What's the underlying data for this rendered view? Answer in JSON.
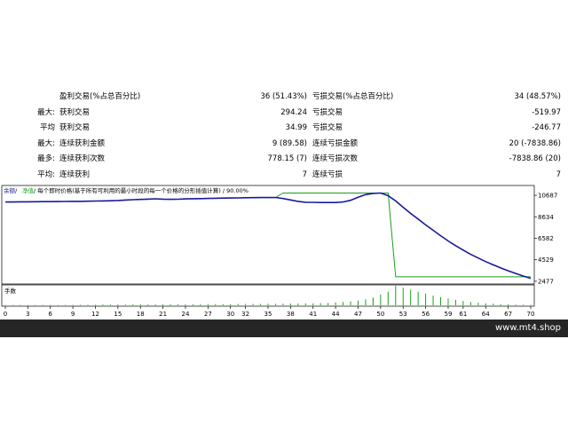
{
  "stats": {
    "rows": [
      {
        "c0": "",
        "c1": "盈利交易(%占总百分比)",
        "c2": "36 (51.43%)",
        "c3": "亏损交易(%占总百分比)",
        "c4": "34 (48.57%)"
      },
      {
        "c0": "最大:",
        "c1": "获利交易",
        "c2": "294.24",
        "c3": "亏损交易",
        "c4": "-519.97"
      },
      {
        "c0": "平均",
        "c1": "获利交易",
        "c2": "34.99",
        "c3": "亏损交易",
        "c4": "-246.77"
      },
      {
        "c0": "最大:",
        "c1": "连续获利金额",
        "c2": "9 (89.58)",
        "c3": "连续亏损金额",
        "c4": "20 (-7838.86)"
      },
      {
        "c0": "最多:",
        "c1": "连续获利次数",
        "c2": "778.15 (7)",
        "c3": "连续亏损次数",
        "c4": "-7838.86 (20)"
      },
      {
        "c0": "平均:",
        "c1": "连续获利",
        "c2": "7",
        "c3": "连续亏损",
        "c4": "7"
      }
    ]
  },
  "chart": {
    "legend": {
      "balance": "余额",
      "sep1": " / ",
      "equity": "净值",
      "rest": " / 每个即时价格(基于所有可利用的最小时段的每一个价格的分形插值计算) / 90.00%"
    },
    "volume_label": "手数",
    "colors": {
      "balance": "#1a1a9c",
      "equity": "#1b9e1b",
      "volume": "#1b9e1b",
      "axis": "#000000"
    },
    "chart_data": {
      "type": "line",
      "x": [
        0,
        1,
        2,
        3,
        4,
        5,
        6,
        7,
        8,
        9,
        10,
        11,
        12,
        13,
        14,
        15,
        16,
        17,
        18,
        19,
        20,
        21,
        22,
        23,
        24,
        25,
        26,
        27,
        28,
        29,
        30,
        31,
        32,
        33,
        34,
        35,
        36,
        37,
        38,
        39,
        40,
        41,
        42,
        43,
        44,
        45,
        46,
        47,
        48,
        49,
        50,
        51,
        52,
        53,
        54,
        55,
        56,
        57,
        58,
        59,
        60,
        61,
        62,
        63,
        64,
        65,
        66,
        67,
        68,
        69,
        70
      ],
      "series": [
        {
          "name": "余额",
          "values": [
            10050,
            10050,
            10060,
            10060,
            10070,
            10080,
            10080,
            10090,
            10100,
            10110,
            10110,
            10120,
            10140,
            10150,
            10170,
            10190,
            10230,
            10270,
            10290,
            10320,
            10350,
            10320,
            10300,
            10310,
            10340,
            10360,
            10370,
            10390,
            10400,
            10420,
            10430,
            10440,
            10450,
            10460,
            10470,
            10470,
            10480,
            10380,
            10240,
            10110,
            10020,
            10010,
            10000,
            10000,
            10000,
            10050,
            10210,
            10500,
            10750,
            10870,
            10900,
            10650,
            10150,
            9550,
            8950,
            8420,
            7860,
            7340,
            6830,
            6330,
            5880,
            5450,
            5050,
            4700,
            4350,
            4050,
            3750,
            3480,
            3220,
            2980,
            2760
          ]
        },
        {
          "name": "净值",
          "values": [
            10050,
            10050,
            10060,
            10060,
            10070,
            10080,
            10080,
            10090,
            10100,
            10110,
            10110,
            10120,
            10140,
            10150,
            10170,
            10190,
            10230,
            10270,
            10290,
            10320,
            10350,
            10320,
            10300,
            10310,
            10340,
            10360,
            10370,
            10390,
            10400,
            10420,
            10430,
            10440,
            10450,
            10460,
            10470,
            10470,
            10480,
            10900,
            10900,
            10900,
            10900,
            10900,
            10900,
            10900,
            10900,
            10900,
            10900,
            10900,
            10900,
            10900,
            10900,
            10900,
            2900,
            2900,
            2900,
            2900,
            2900,
            2900,
            2900,
            2900,
            2900,
            2900,
            2900,
            2900,
            2900,
            2900,
            2900,
            2900,
            2900,
            2900,
            2900
          ]
        }
      ],
      "volume": [
        0.02,
        0.02,
        0.02,
        0.02,
        0.02,
        0.02,
        0.02,
        0.02,
        0.02,
        0.02,
        0.03,
        0.03,
        0.03,
        0.04,
        0.04,
        0.04,
        0.04,
        0.05,
        0.05,
        0.05,
        0.05,
        0.05,
        0.05,
        0.05,
        0.05,
        0.05,
        0.06,
        0.06,
        0.06,
        0.06,
        0.06,
        0.07,
        0.07,
        0.07,
        0.07,
        0.08,
        0.08,
        0.08,
        0.09,
        0.09,
        0.1,
        0.1,
        0.11,
        0.12,
        0.14,
        0.17,
        0.2,
        0.25,
        0.3,
        0.4,
        0.55,
        0.7,
        1.0,
        0.9,
        0.8,
        0.7,
        0.6,
        0.5,
        0.42,
        0.35,
        0.28,
        0.22,
        0.17,
        0.13,
        0.1,
        0.08,
        0.06,
        0.05,
        0.04,
        0.03,
        0.02
      ],
      "yticks": [
        2477,
        4529,
        6582,
        8634,
        10687
      ],
      "ylim": [
        2300,
        11200
      ],
      "xticks": [
        0,
        3,
        6,
        9,
        12,
        15,
        18,
        21,
        24,
        27,
        30,
        32,
        35,
        38,
        41,
        44,
        47,
        50,
        53,
        56,
        59,
        61,
        64,
        67,
        70
      ],
      "xlim": [
        0,
        70
      ],
      "grid": false,
      "legend": "top-left"
    }
  },
  "footer": {
    "site": "www.mt4.shop"
  }
}
